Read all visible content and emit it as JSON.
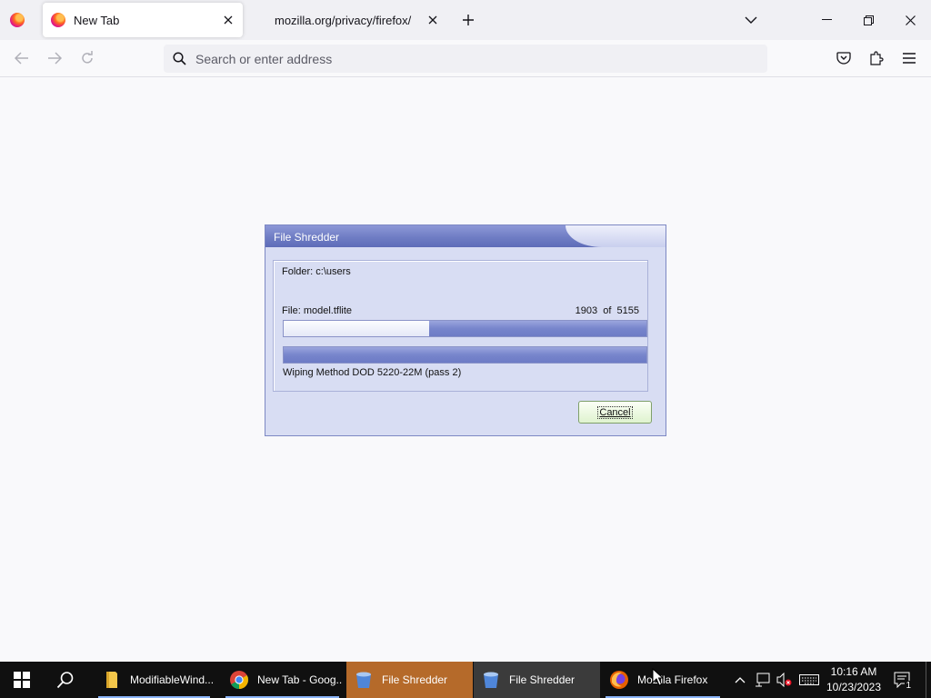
{
  "browser": {
    "tabs": [
      {
        "title": "New Tab",
        "active": true
      },
      {
        "title": "mozilla.org/privacy/firefox/",
        "active": false
      }
    ],
    "urlbar": {
      "placeholder": "Search or enter address",
      "value": ""
    }
  },
  "dialog": {
    "title": "File Shredder",
    "folder_label": "Folder: c:\\users",
    "file_label": "File: model.tflite",
    "count_current": "1903",
    "count_of": "of",
    "count_total": "5155",
    "file_progress": 0.4,
    "pass_progress": 1.0,
    "method_label": "Wiping Method DOD 5220-22M  (pass 2)",
    "cancel_label": "Cancel"
  },
  "taskbar": {
    "apps": [
      {
        "label": "ModifiableWind...",
        "icon": "folder-icon"
      },
      {
        "label": "New Tab - Goog...",
        "icon": "chrome-icon"
      },
      {
        "label": "File Shredder",
        "icon": "shredder-icon"
      },
      {
        "label": "File Shredder",
        "icon": "shredder-icon"
      },
      {
        "label": "Mozilla Firefox",
        "icon": "firefox-icon"
      }
    ],
    "clock": {
      "time": "10:16 AM",
      "date": "10/23/2023"
    },
    "notification_count": "1"
  },
  "colors": {
    "dialog_title": "#6f7dc4",
    "progress_fill": "#7785cc",
    "cancel_button": "#dff3cf",
    "taskbar_active": "#b56a2a",
    "taskbar_bg": "#101010"
  }
}
